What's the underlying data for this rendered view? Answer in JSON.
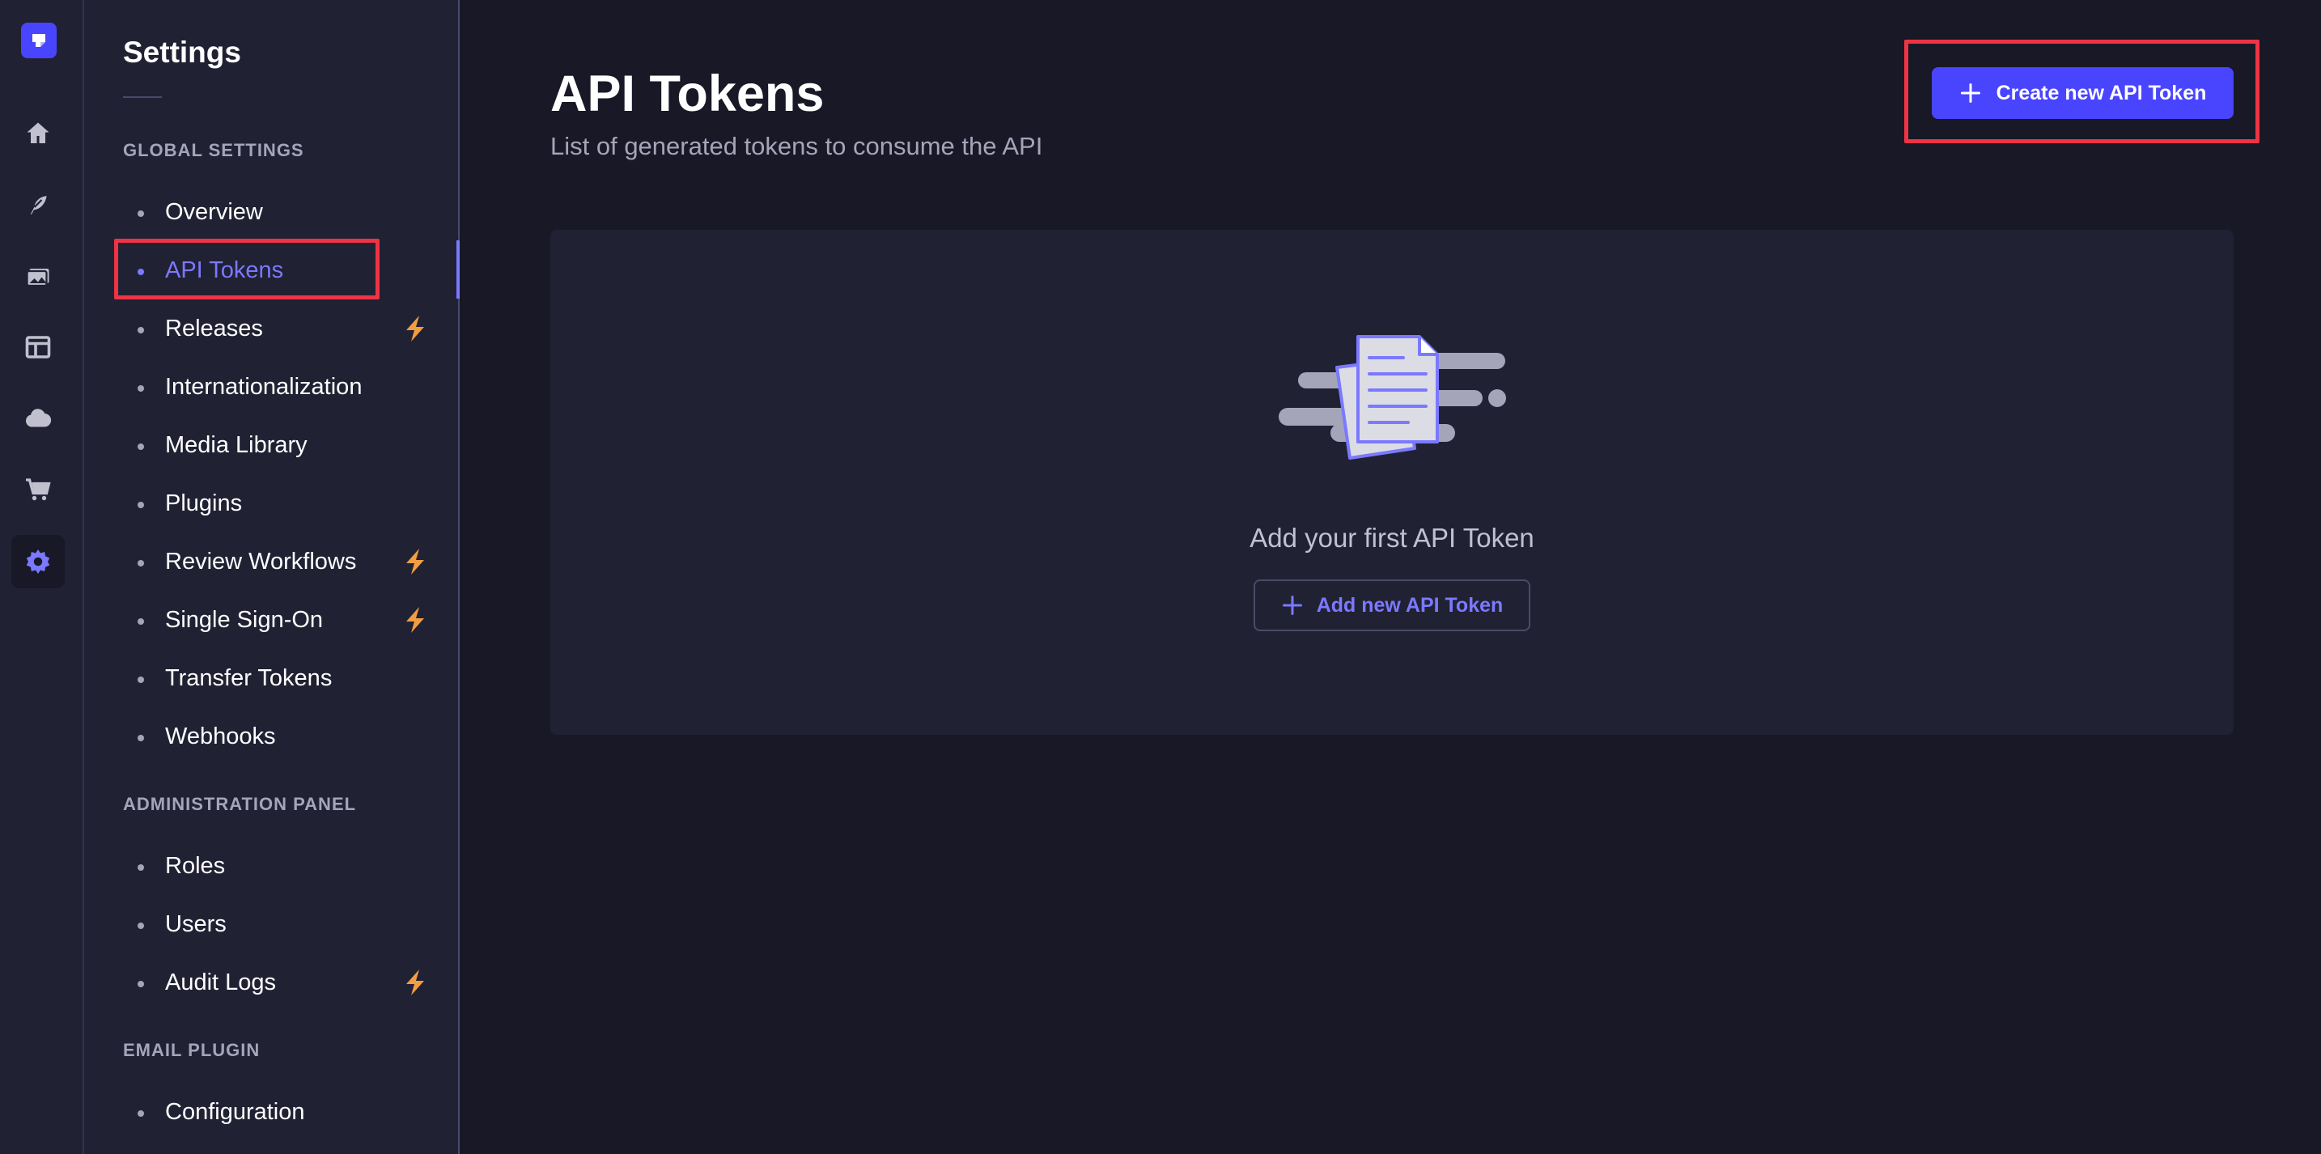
{
  "sidebar": {
    "title": "Settings",
    "sections": [
      {
        "label": "GLOBAL SETTINGS",
        "items": [
          {
            "label": "Overview"
          },
          {
            "label": "API Tokens",
            "active": true
          },
          {
            "label": "Releases",
            "badge": "lightning-icon"
          },
          {
            "label": "Internationalization"
          },
          {
            "label": "Media Library"
          },
          {
            "label": "Plugins"
          },
          {
            "label": "Review Workflows",
            "badge": "lightning-icon"
          },
          {
            "label": "Single Sign-On",
            "badge": "lightning-icon"
          },
          {
            "label": "Transfer Tokens"
          },
          {
            "label": "Webhooks"
          }
        ]
      },
      {
        "label": "ADMINISTRATION PANEL",
        "items": [
          {
            "label": "Roles"
          },
          {
            "label": "Users"
          },
          {
            "label": "Audit Logs",
            "badge": "lightning-icon"
          }
        ]
      },
      {
        "label": "EMAIL PLUGIN",
        "items": [
          {
            "label": "Configuration"
          }
        ]
      }
    ]
  },
  "rail": {
    "icons": [
      "logo-icon",
      "home-icon",
      "feather-icon",
      "media-icon",
      "layout-icon",
      "cloud-icon",
      "cart-icon",
      "gear-icon"
    ],
    "active": "gear-icon"
  },
  "main": {
    "title": "API Tokens",
    "subtitle": "List of generated tokens to consume the API",
    "create_button": "Create new API Token",
    "empty_state": {
      "message": "Add your first API Token",
      "button": "Add new API Token",
      "illustration": "documents-icon"
    }
  },
  "colors": {
    "background": "#181826",
    "panel": "#212134",
    "primary": "#4945ff",
    "accent": "#7b79ff",
    "badge": "#f29d41",
    "highlight": "#ee3344"
  }
}
